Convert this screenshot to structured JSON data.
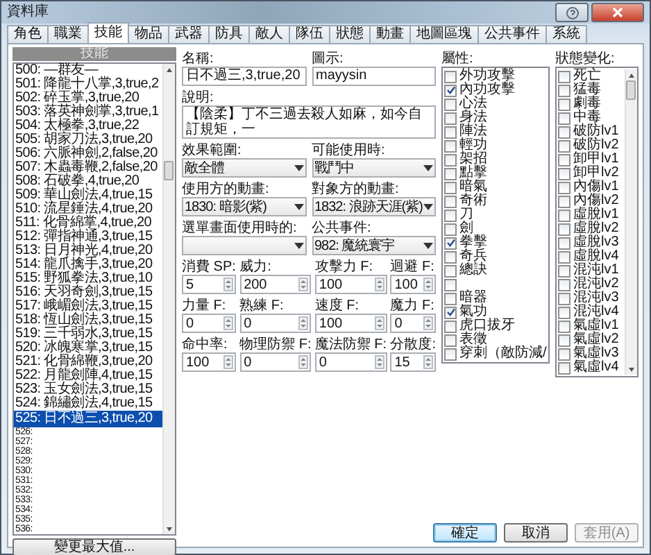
{
  "window": {
    "title": "資料庫"
  },
  "tabs": [
    {
      "label": "角色",
      "selected": false
    },
    {
      "label": "職業",
      "selected": false
    },
    {
      "label": "技能",
      "selected": true
    },
    {
      "label": "物品",
      "selected": false
    },
    {
      "label": "武器",
      "selected": false
    },
    {
      "label": "防具",
      "selected": false
    },
    {
      "label": "敵人",
      "selected": false
    },
    {
      "label": "隊伍",
      "selected": false
    },
    {
      "label": "狀態",
      "selected": false
    },
    {
      "label": "動畫",
      "selected": false
    },
    {
      "label": "地圖區塊",
      "selected": false
    },
    {
      "label": "公共事件",
      "selected": false
    },
    {
      "label": "系統",
      "selected": false
    }
  ],
  "skill_list": {
    "header": "技能",
    "button": "變更最大值...",
    "items": [
      {
        "text": "500: —群友—",
        "kind": "entry",
        "selected": false
      },
      {
        "text": "501: 降龍十八掌,3,true,2",
        "kind": "entry",
        "selected": false
      },
      {
        "text": "502: 碎玉掌,3,true,20",
        "kind": "entry",
        "selected": false
      },
      {
        "text": "503: 落英神劍掌,3,true,1",
        "kind": "entry",
        "selected": false
      },
      {
        "text": "504: 太極拳,3,true,22",
        "kind": "entry",
        "selected": false
      },
      {
        "text": "505: 胡家刀法,3,true,20",
        "kind": "entry",
        "selected": false
      },
      {
        "text": "506: 六脈神劍,2,false,20",
        "kind": "entry",
        "selected": false
      },
      {
        "text": "507: 木蟲毒鞭,2,false,20",
        "kind": "entry",
        "selected": false
      },
      {
        "text": "508: 石破拳,4,true,20",
        "kind": "entry",
        "selected": false
      },
      {
        "text": "509: 華山劍法,4,true,15",
        "kind": "entry",
        "selected": false
      },
      {
        "text": "510: 流星錘法,4,true,20",
        "kind": "entry",
        "selected": false
      },
      {
        "text": "511: 化骨綿掌,4,true,20",
        "kind": "entry",
        "selected": false
      },
      {
        "text": "512: 彈指神通,3,true,15",
        "kind": "entry",
        "selected": false
      },
      {
        "text": "513: 日月神光,4,true,20",
        "kind": "entry",
        "selected": false
      },
      {
        "text": "514: 龍爪擒手,3,true,20",
        "kind": "entry",
        "selected": false
      },
      {
        "text": "515: 野狐拳法,3,true,10",
        "kind": "entry",
        "selected": false
      },
      {
        "text": "516: 天羽奇劍,3,true,15",
        "kind": "entry",
        "selected": false
      },
      {
        "text": "517: 峨嵋劍法,3,true,15",
        "kind": "entry",
        "selected": false
      },
      {
        "text": "518: 恆山劍法,3,true,15",
        "kind": "entry",
        "selected": false
      },
      {
        "text": "519: 三千弱水,3,true,15",
        "kind": "entry",
        "selected": false
      },
      {
        "text": "520: 冰魄寒掌,3,true,15",
        "kind": "entry",
        "selected": false
      },
      {
        "text": "521: 化骨綿鞭,3,true,20",
        "kind": "entry",
        "selected": false
      },
      {
        "text": "522: 月龍劍陣,4,true,15",
        "kind": "entry",
        "selected": false
      },
      {
        "text": "523: 玉女劍法,3,true,15",
        "kind": "entry",
        "selected": false
      },
      {
        "text": "524: 錦繡劍法,4,true,15",
        "kind": "entry",
        "selected": false
      },
      {
        "text": "525: 日不過三,3,true,20",
        "kind": "entry",
        "selected": true
      },
      {
        "text": "526:",
        "kind": "empty",
        "selected": false
      },
      {
        "text": "527:",
        "kind": "empty",
        "selected": false
      },
      {
        "text": "528:",
        "kind": "empty",
        "selected": false
      },
      {
        "text": "529:",
        "kind": "empty",
        "selected": false
      },
      {
        "text": "530:",
        "kind": "empty",
        "selected": false
      },
      {
        "text": "531:",
        "kind": "empty",
        "selected": false
      },
      {
        "text": "532:",
        "kind": "empty",
        "selected": false
      },
      {
        "text": "533:",
        "kind": "empty",
        "selected": false
      },
      {
        "text": "534:",
        "kind": "empty",
        "selected": false
      },
      {
        "text": "535:",
        "kind": "empty",
        "selected": false
      },
      {
        "text": "536:",
        "kind": "empty",
        "selected": false
      }
    ]
  },
  "form": {
    "name": {
      "label": "名稱:",
      "value": "日不過三,3,true,20"
    },
    "icon": {
      "label": "圖示:",
      "value": "mayysin"
    },
    "description": {
      "label": "說明:",
      "value": "【陰柔】丁不三過去殺人如麻，如今自訂規矩，一"
    },
    "dropdowns": [
      {
        "label": "效果範圍:",
        "value": "敵全體"
      },
      {
        "label": "可能使用時:",
        "value": "戰鬥中"
      },
      {
        "label": "使用方的動畫:",
        "value": "1830: 暗影(紫)"
      },
      {
        "label": "對象方的動畫:",
        "value": "1832: 浪跡天涯(紫)"
      },
      {
        "label": "選單畫面使用時的:"
      },
      {
        "label": "公共事件:",
        "value": "982: 魔統寰宇"
      }
    ],
    "spinners": [
      {
        "label": "消費 SP:",
        "value": "5"
      },
      {
        "label": "威力:",
        "value": "200"
      },
      {
        "label": "攻擊力 F:",
        "value": "100"
      },
      {
        "label": "迴避 F:",
        "value": "100"
      },
      {
        "label": "力量 F:",
        "value": "0"
      },
      {
        "label": "熟練 F:",
        "value": "0"
      },
      {
        "label": "速度 F:",
        "value": "100"
      },
      {
        "label": "魔力 F:",
        "value": "0"
      },
      {
        "label": "命中率:",
        "value": "100"
      },
      {
        "label": "物理防禦 F:",
        "value": "0"
      },
      {
        "label": "魔法防禦 F:",
        "value": "0"
      },
      {
        "label": "分散度:",
        "value": "15"
      }
    ]
  },
  "attributes": {
    "label": "屬性:",
    "items": [
      {
        "label": "外功攻擊",
        "checked": false
      },
      {
        "label": "內功攻擊",
        "checked": true
      },
      {
        "label": "心法",
        "checked": false
      },
      {
        "label": "身法",
        "checked": false
      },
      {
        "label": "陣法",
        "checked": false
      },
      {
        "label": "輕功",
        "checked": false
      },
      {
        "label": "架招",
        "checked": false
      },
      {
        "label": "點擊",
        "checked": false
      },
      {
        "label": "暗氣",
        "checked": false
      },
      {
        "label": "奇術",
        "checked": false
      },
      {
        "label": "刀",
        "checked": false
      },
      {
        "label": "劍",
        "checked": false
      },
      {
        "label": "拳擊",
        "checked": true
      },
      {
        "label": "奇兵",
        "checked": false
      },
      {
        "label": "總訣",
        "checked": false
      },
      {
        "checked": false
      },
      {
        "label": "暗器",
        "checked": false
      },
      {
        "label": "氣功",
        "checked": true
      },
      {
        "label": "虎口拔牙",
        "checked": false
      },
      {
        "label": "表徵",
        "checked": false
      },
      {
        "label": "穿刺（敵防減/",
        "checked": false
      }
    ]
  },
  "states": {
    "label": "狀態變化:",
    "items": [
      {
        "label": "死亡",
        "checked": false
      },
      {
        "label": "猛毒",
        "checked": false
      },
      {
        "label": "劇毒",
        "checked": false
      },
      {
        "label": "中毒",
        "checked": false
      },
      {
        "label": "破防lv1",
        "checked": false
      },
      {
        "label": "破防lv2",
        "checked": false
      },
      {
        "label": "卸甲lv1",
        "checked": false
      },
      {
        "label": "卸甲lv2",
        "checked": false
      },
      {
        "label": "內傷lv1",
        "checked": false
      },
      {
        "label": "內傷lv2",
        "checked": false
      },
      {
        "label": "虛脫lv1",
        "checked": false
      },
      {
        "label": "虛脫lv2",
        "checked": false
      },
      {
        "label": "虛脫lv3",
        "checked": false
      },
      {
        "label": "虛脫lv4",
        "checked": false
      },
      {
        "label": "混沌lv1",
        "checked": false
      },
      {
        "label": "混沌lv2",
        "checked": false
      },
      {
        "label": "混沌lv3",
        "checked": false
      },
      {
        "label": "混沌lv4",
        "checked": false
      },
      {
        "label": "氣虛lv1",
        "checked": false
      },
      {
        "label": "氣虛lv2",
        "checked": false
      },
      {
        "label": "氣虛lv3",
        "checked": false
      },
      {
        "label": "氣虛lv4",
        "checked": false
      }
    ]
  },
  "buttons": [
    {
      "label": "確定",
      "focused": true,
      "disabled": false
    },
    {
      "label": "取消",
      "focused": false,
      "disabled": false
    },
    {
      "label": "套用(A)",
      "focused": false,
      "disabled": true
    }
  ]
}
